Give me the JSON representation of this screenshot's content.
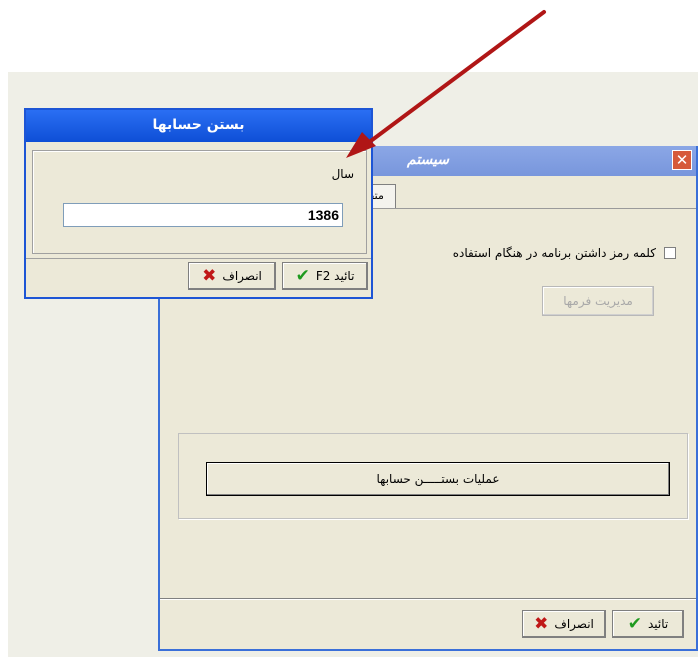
{
  "system_window": {
    "title": "سیستم",
    "close_glyph": "✕",
    "tab_label": "متفر",
    "password_checkbox_label": "کلمه رمز داشتن برنامه در هنگام استفاده",
    "form_manage_button": "مدیریت فرمها",
    "close_accounts_button": "عملیات بستـــــن حسابها",
    "ok_button": "تائید",
    "cancel_button": "انصراف"
  },
  "close_accounts_dialog": {
    "title": "بستن حسابها",
    "year_label": "سال",
    "year_value": "1386",
    "ok_button": "تائید F2",
    "cancel_button": "انصراف"
  },
  "icons": {
    "ok": "check-icon",
    "cancel": "x-icon",
    "close": "close-icon"
  },
  "colors": {
    "dialog_title": "#0e4fd6",
    "back_title": "#7896dc",
    "arrow": "#b01616",
    "ok_check": "#1f9a1f",
    "cancel_x": "#c01818"
  }
}
